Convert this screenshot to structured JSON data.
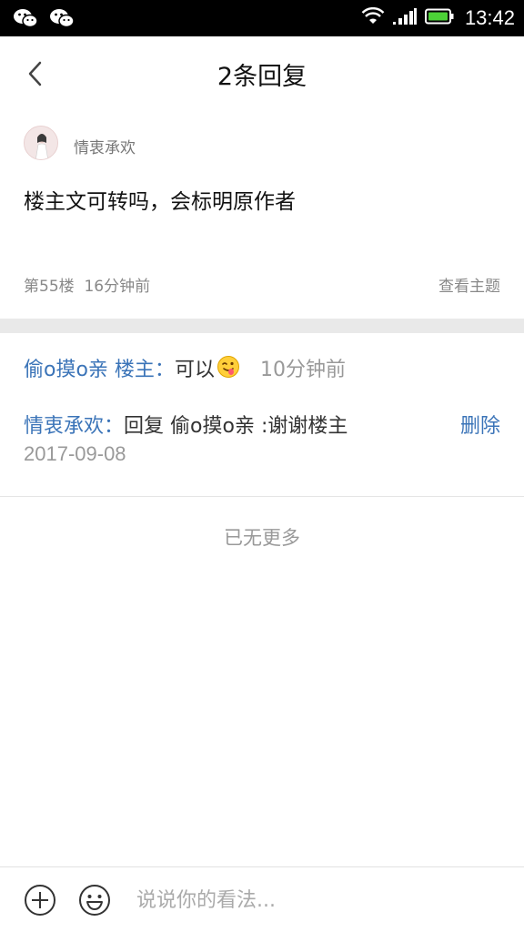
{
  "status_bar": {
    "time": "13:42",
    "left_icons": [
      "wechat-icon",
      "wechat-icon"
    ],
    "right_icons": [
      "wifi-icon",
      "signal-icon",
      "battery-icon"
    ],
    "battery_color": "#4cd137"
  },
  "header": {
    "title": "2条回复"
  },
  "post": {
    "author": "情衷承欢",
    "content": "楼主文可转吗，会标明原作者",
    "meta": "第55楼  16分钟前",
    "view_topic": "查看主题"
  },
  "replies": [
    {
      "name": "偷o摸o亲 楼主",
      "colon": "：",
      "text": "可以",
      "emoji": "tongue-wink-emoji-icon",
      "time": "10分钟前"
    },
    {
      "name": "情衷承欢",
      "colon": "：",
      "text": "回复 偷o摸o亲 :谢谢楼主",
      "delete": "删除",
      "date": "2017-09-08"
    }
  ],
  "footer_text": "已无更多",
  "bottom_bar": {
    "placeholder": "说说你的看法..."
  },
  "colors": {
    "link_blue": "#3b74b8",
    "muted_gray": "#999999",
    "divider": "#e9e9e9"
  }
}
